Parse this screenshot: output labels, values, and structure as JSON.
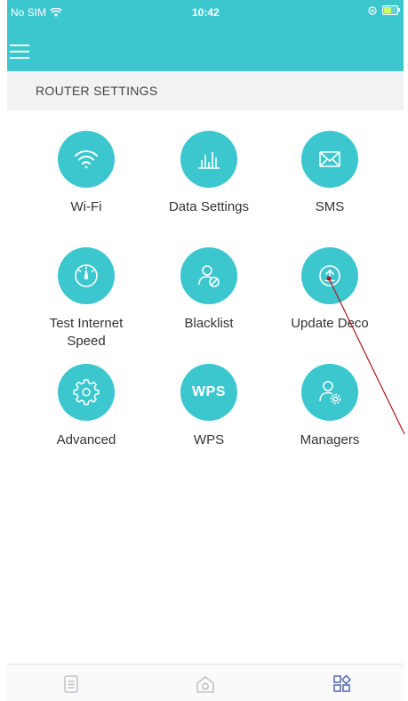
{
  "status_bar": {
    "carrier": "No SIM",
    "time": "10:42",
    "battery_level": 0.6
  },
  "header": {
    "menu_icon": "hamburger-menu-icon"
  },
  "section": {
    "title": "ROUTER SETTINGS"
  },
  "tiles": [
    {
      "label": "Wi-Fi",
      "icon": "wifi-icon"
    },
    {
      "label": "Data Settings",
      "icon": "bar-chart-icon"
    },
    {
      "label": "SMS",
      "icon": "envelope-icon"
    },
    {
      "label": "Test Internet Speed",
      "icon": "speedometer-icon"
    },
    {
      "label": "Blacklist",
      "icon": "blocked-user-icon"
    },
    {
      "label": "Update Deco",
      "icon": "upload-icon"
    },
    {
      "label": "Advanced",
      "icon": "gear-icon"
    },
    {
      "label": "WPS",
      "icon": "wps-icon",
      "icon_text": "WPS"
    },
    {
      "label": "Managers",
      "icon": "user-settings-icon"
    }
  ],
  "tabbar": {
    "tabs": [
      "list-icon",
      "home-icon",
      "more-apps-icon"
    ],
    "active_index": 2
  },
  "colors": {
    "accent": "#3cc7cf",
    "active_tab": "#4a5ea8",
    "inactive_tab": "#b5b8bd",
    "annotation_line": "#b0161d"
  }
}
